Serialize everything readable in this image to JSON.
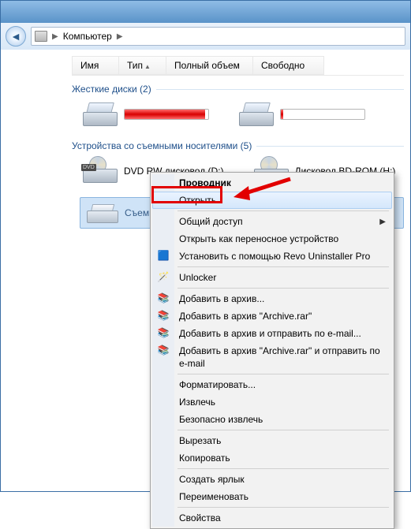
{
  "address": {
    "segment": "Компьютер"
  },
  "headers": {
    "name": "Имя",
    "type": "Тип",
    "total": "Полный объем",
    "free": "Свободно"
  },
  "group_hdd": "Жесткие диски (2)",
  "group_removable": "Устройства со съемными носителями (5)",
  "drives": {
    "dvd": "DVD RW дисковод (D:)",
    "bd": "Дисковод BD-ROM (H:)",
    "removable": "Съемный диск (F:)"
  },
  "context_menu": {
    "title": "Проводник",
    "open": "Открыть",
    "share": "Общий доступ",
    "open_portable": "Открыть как переносное устройство",
    "revo": "Установить с помощью Revo Uninstaller Pro",
    "unlocker": "Unlocker",
    "add_archive": "Добавить в архив...",
    "add_archive_rar": "Добавить в архив \"Archive.rar\"",
    "add_email": "Добавить в архив и отправить по e-mail...",
    "add_rar_email": "Добавить в архив \"Archive.rar\" и отправить по e-mail",
    "format": "Форматировать...",
    "eject": "Извлечь",
    "safe_eject": "Безопасно извлечь",
    "cut": "Вырезать",
    "copy": "Копировать",
    "shortcut": "Создать ярлык",
    "rename": "Переименовать",
    "properties": "Свойства"
  }
}
